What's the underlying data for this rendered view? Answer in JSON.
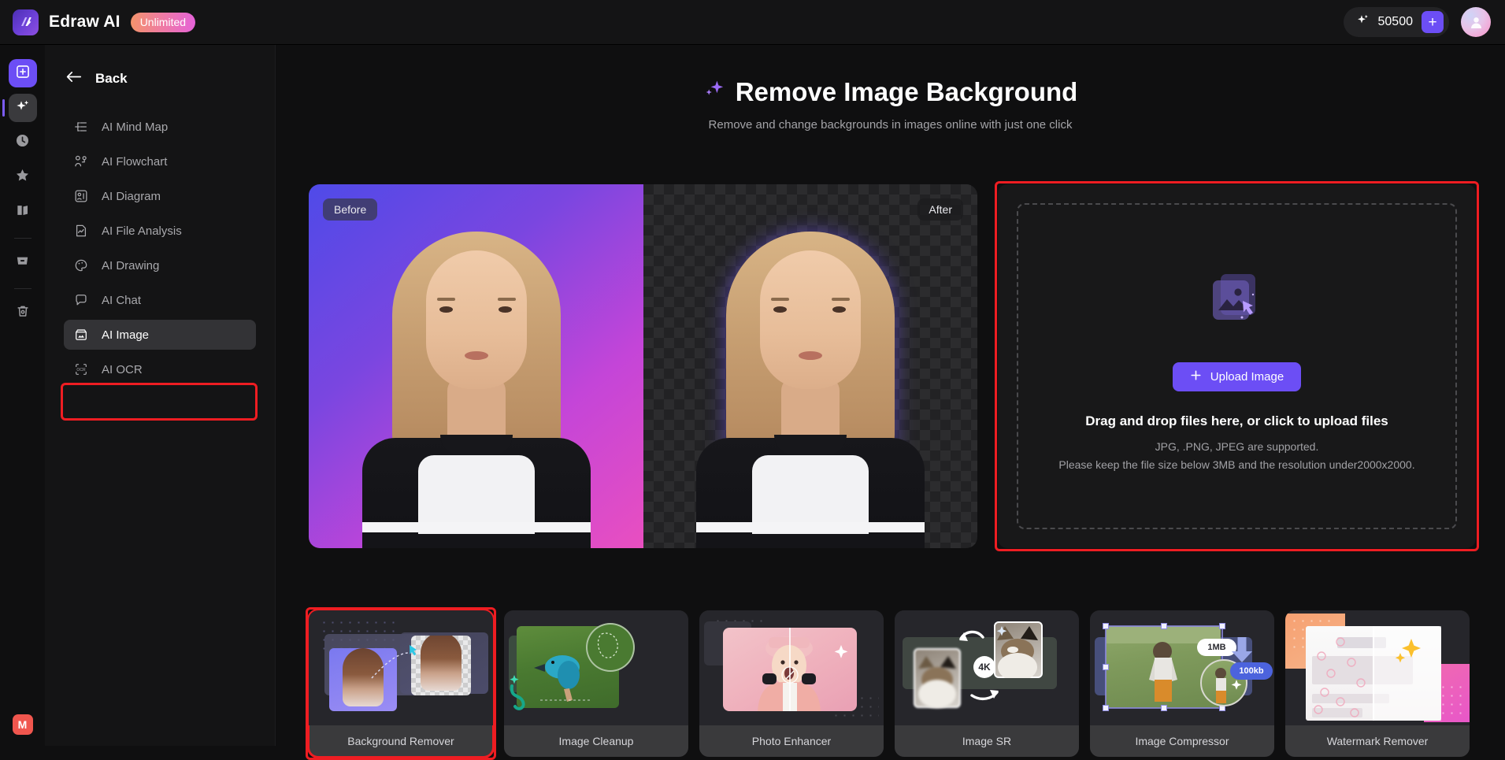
{
  "topbar": {
    "brand_name": "Edraw AI",
    "plan_badge": "Unlimited",
    "credits_value": "50500",
    "credits_add_label": "+",
    "logo_icon": "edraw-logo-icon",
    "credits_icon": "sparkle-icon",
    "avatar_icon": "user-avatar-icon"
  },
  "rail": {
    "items": [
      {
        "name": "new-document-button",
        "icon": "plus-square-icon",
        "state": "primary"
      },
      {
        "name": "ai-tools-button",
        "icon": "sparkles-icon",
        "state": "active"
      },
      {
        "name": "recent-button",
        "icon": "clock-icon",
        "state": "normal"
      },
      {
        "name": "favorites-button",
        "icon": "star-icon",
        "state": "normal"
      },
      {
        "name": "templates-button",
        "icon": "templates-icon",
        "state": "normal"
      },
      {
        "name": "files-button",
        "icon": "folder-icon",
        "state": "normal"
      },
      {
        "name": "trash-button",
        "icon": "trash-icon",
        "state": "normal"
      }
    ],
    "bottom_badge": "M"
  },
  "nav": {
    "back_label": "Back",
    "back_icon": "arrow-left-icon",
    "items": [
      {
        "label": "AI Mind Map",
        "icon": "mindmap-icon",
        "active": false
      },
      {
        "label": "AI Flowchart",
        "icon": "flowchart-icon",
        "active": false
      },
      {
        "label": "AI Diagram",
        "icon": "diagram-icon",
        "active": false
      },
      {
        "label": "AI File Analysis",
        "icon": "file-analysis-icon",
        "active": false
      },
      {
        "label": "AI Drawing",
        "icon": "palette-icon",
        "active": false
      },
      {
        "label": "AI Chat",
        "icon": "chat-bubble-icon",
        "active": false
      },
      {
        "label": "AI Image",
        "icon": "image-icon",
        "active": true
      },
      {
        "label": "AI OCR",
        "icon": "ocr-icon",
        "active": false
      }
    ]
  },
  "page": {
    "title": "Remove Image Background",
    "title_icon": "sparkle-icon",
    "subtitle": "Remove and change backgrounds in images online with just one click"
  },
  "preview": {
    "before_label": "Before",
    "after_label": "After"
  },
  "upload": {
    "illustration_icon": "image-upload-icon",
    "button_label": "Upload Image",
    "button_icon": "plus-icon",
    "drop_title": "Drag and drop files here, or click to upload files",
    "formats_line": "JPG, .PNG, JPEG are supported.",
    "limits_line": "Please keep the file size below 3MB and the resolution under2000x2000."
  },
  "tools": [
    {
      "label": "Background Remover",
      "selected": true,
      "badges": []
    },
    {
      "label": "Image Cleanup",
      "selected": false,
      "badges": []
    },
    {
      "label": "Photo Enhancer",
      "selected": false,
      "badges": []
    },
    {
      "label": "Image SR",
      "selected": false,
      "badges": [
        "4K"
      ]
    },
    {
      "label": "Image Compressor",
      "selected": false,
      "badges": [
        "1MB",
        "100kb"
      ]
    },
    {
      "label": "Watermark Remover",
      "selected": false,
      "badges": []
    }
  ],
  "colors": {
    "accent": "#6c4ef5",
    "highlight": "#ee1d22",
    "app_bg": "#0f0f10",
    "panel_bg": "#141415",
    "card_bg": "#1e1e20"
  }
}
